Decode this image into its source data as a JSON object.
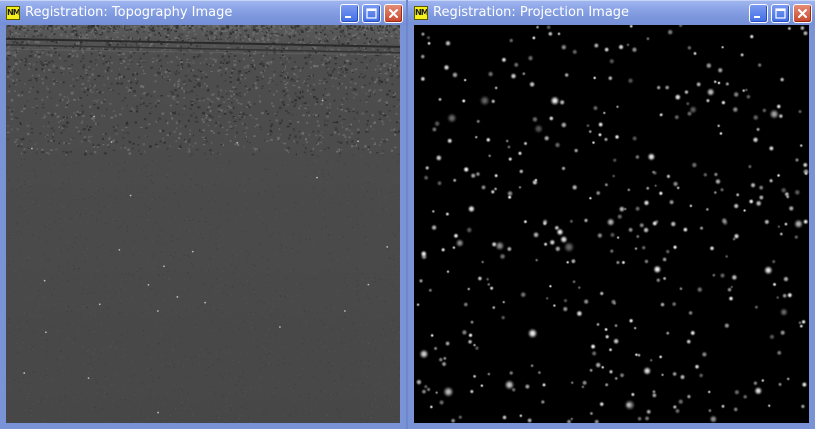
{
  "windows": [
    {
      "title": "Registration: Topography Image",
      "icon": "nm-app-icon",
      "icon_text": "NM",
      "image": "topography-image"
    },
    {
      "title": "Registration: Projection Image",
      "icon": "nm-app-icon",
      "icon_text": "NM",
      "image": "projection-image"
    }
  ],
  "colors": {
    "titlebar": "#7d97dd",
    "frame": "#7a93d6",
    "topography_background": "#4a4a4a",
    "projection_background": "#000000",
    "close_button": "#c9472d"
  }
}
